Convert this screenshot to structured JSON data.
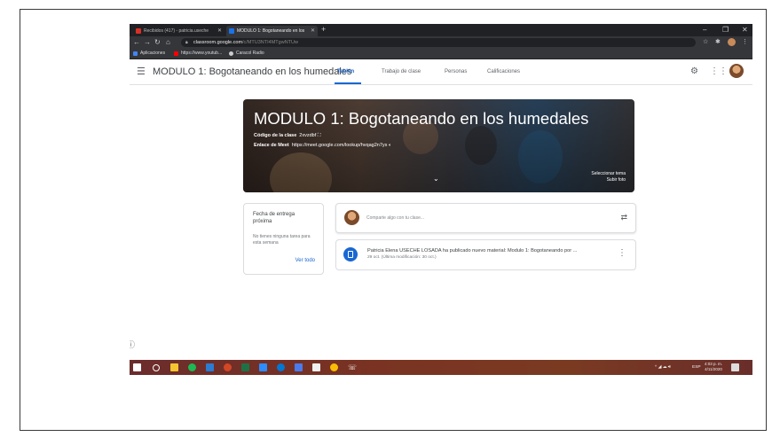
{
  "browser": {
    "tabs": [
      {
        "label": "Recibidos (417) - patricia.useche",
        "color": "#d93025",
        "active": false
      },
      {
        "label": "MODULO 1: Bogotaneando en los",
        "color": "#1a73e8",
        "active": true
      }
    ],
    "new_tab": "+",
    "window_controls": [
      "–",
      "❐",
      "✕"
    ],
    "url_host": "classroom.google.com",
    "url_path": "/c/MTU3NTI4MTgwNTUw",
    "bookmarks": [
      {
        "label": "Aplicaciones",
        "color": "#4285f4"
      },
      {
        "label": "https://www.youtub...",
        "color": "#ff0000"
      },
      {
        "label": "Caracol Radio",
        "color": "#cccccc"
      }
    ]
  },
  "classroom": {
    "title": "MODULO 1: Bogotaneando en los humedales",
    "nav_tabs": [
      "Tablón",
      "Trabajo de clase",
      "Personas",
      "Calificaciones"
    ],
    "active_tab": "Tablón"
  },
  "banner": {
    "title": "MODULO 1: Bogotaneando en los humedales",
    "code_label": "Código de la clase",
    "code_value": "2xvzdbf",
    "meet_label": "Enlace de Meet",
    "meet_value": "https://meet.google.com/lookup/hvqag2n7ys",
    "select_theme": "Seleccionar tema",
    "upload_photo": "Subir foto"
  },
  "upcoming": {
    "title": "Fecha de entrega próxima",
    "empty": "No tienes ninguna tarea para esta semana",
    "view_all": "Ver todo"
  },
  "share": {
    "placeholder": "Comparte algo con tu clase..."
  },
  "post": {
    "text": "Patricia Elena USECHE LOSADA ha publicado nuevo material: Modulo 1: Bogotaneando por ...",
    "date": "29 oct. (Última modificación: 30 oct.)"
  },
  "taskbar": {
    "tray_lang": "ESP",
    "time": "4:03 p. m.",
    "date": "4/11/2020"
  }
}
